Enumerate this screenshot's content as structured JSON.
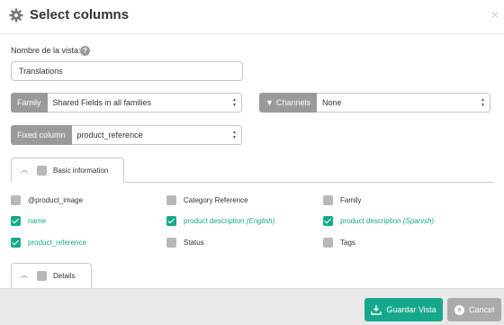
{
  "modal": {
    "title": "Select columns",
    "close_symbol": "×"
  },
  "view_name": {
    "label": "Nombre de la vista:",
    "help_symbol": "?",
    "value": "Translations"
  },
  "family": {
    "label": "Family",
    "selected": "Shared Fields in all families"
  },
  "channels": {
    "label": "Channels",
    "selected": "None"
  },
  "fixed_column": {
    "label": "Fixed column",
    "selected": "product_reference"
  },
  "groups": [
    {
      "label": "Basic information",
      "fields": [
        {
          "label": "@product_image",
          "checked": false
        },
        {
          "label": "Category Reference",
          "checked": false
        },
        {
          "label": "Family",
          "checked": false
        },
        {
          "label": "name",
          "checked": true
        },
        {
          "label": "product description",
          "suffix": "(English)",
          "checked": true
        },
        {
          "label": "product description",
          "suffix": "(Spanish)",
          "checked": true
        },
        {
          "label": "product_reference",
          "checked": true
        },
        {
          "label": "Status",
          "checked": false
        },
        {
          "label": "Tags",
          "checked": false
        }
      ]
    },
    {
      "label": "Details",
      "fields": []
    }
  ],
  "footer": {
    "save_label": "Guardar Vista",
    "cancel_label": "Cancel"
  },
  "colors": {
    "accent": "#16a88a",
    "addon_gray": "#9a9a9a",
    "cancel_gray": "#aaaaaa"
  },
  "icons": [
    "gear-icon",
    "close-icon",
    "help-icon",
    "filter-icon",
    "chevron-up-icon",
    "checkbox-icon",
    "save-icon",
    "cancel-circle-icon"
  ]
}
